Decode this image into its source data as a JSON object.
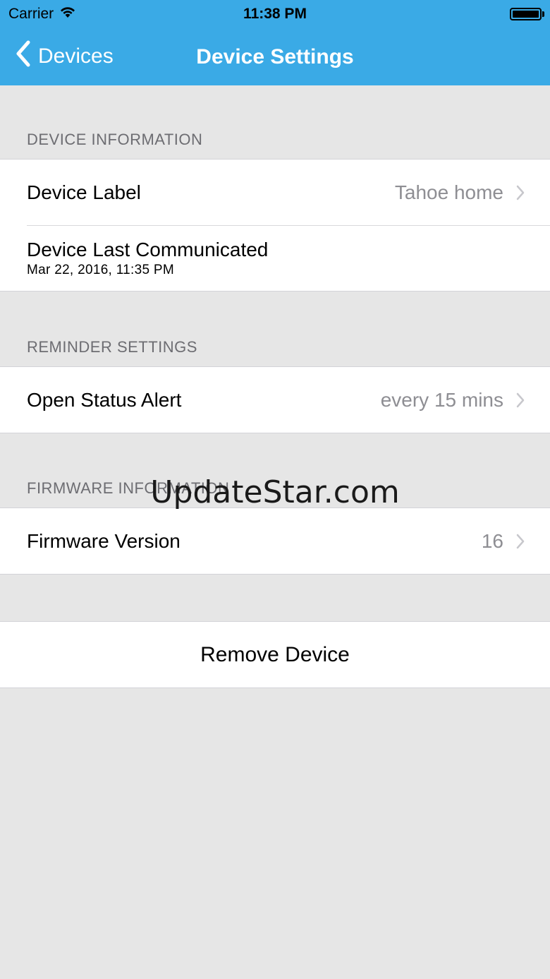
{
  "status_bar": {
    "carrier": "Carrier",
    "time": "11:38 PM"
  },
  "nav": {
    "back_label": "Devices",
    "title": "Device Settings"
  },
  "sections": {
    "device_information": {
      "header": "DEVICE INFORMATION",
      "device_label": {
        "label": "Device Label",
        "value": "Tahoe home"
      },
      "last_communicated": {
        "label": "Device Last Communicated",
        "value": "Mar 22, 2016, 11:35 PM"
      }
    },
    "reminder_settings": {
      "header": "REMINDER SETTINGS",
      "open_status_alert": {
        "label": "Open Status Alert",
        "value": "every 15 mins"
      }
    },
    "firmware_information": {
      "header": "FIRMWARE INFORMATION",
      "firmware_version": {
        "label": "Firmware Version",
        "value": "16"
      }
    }
  },
  "remove_button": {
    "label": "Remove Device"
  },
  "watermark": "UpdateStar.com",
  "colors": {
    "nav_background": "#3aaae6",
    "page_background": "#e6e6e6",
    "secondary_text": "#8e8e93"
  }
}
